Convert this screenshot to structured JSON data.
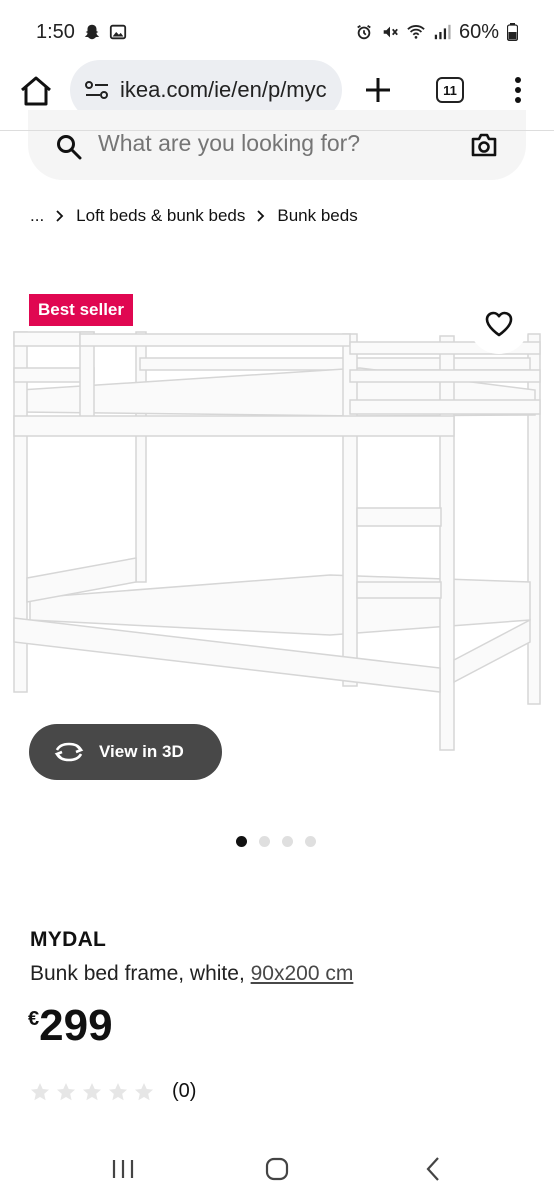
{
  "status_bar": {
    "time": "1:50",
    "battery": "60%"
  },
  "browser": {
    "url": "ikea.com/ie/en/p/myc",
    "tab_count": "11"
  },
  "search": {
    "placeholder": "What are you looking for?"
  },
  "breadcrumb": {
    "items": [
      "...",
      "Loft beds & bunk beds",
      "Bunk beds"
    ]
  },
  "gallery": {
    "badge": "Best seller",
    "view_3d_label": "View in 3D",
    "image_count": 4,
    "active_index": 0
  },
  "product": {
    "name": "MYDAL",
    "description": "Bunk bed frame, white,",
    "size": "90x200 cm",
    "currency": "€",
    "price": "299",
    "rating_stars": 0,
    "rating_count": "(0)"
  },
  "colors": {
    "badge": "#e00751",
    "view_3d_button": "#484848"
  }
}
